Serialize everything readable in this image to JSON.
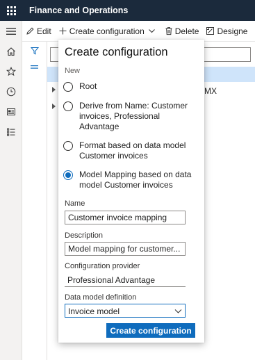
{
  "app": {
    "title": "Finance and Operations"
  },
  "actions": {
    "edit": "Edit",
    "create_configuration": "Create configuration",
    "delete": "Delete",
    "designer": "Designe"
  },
  "background": {
    "row_fragment": "MX"
  },
  "dialog": {
    "title": "Create configuration",
    "section_new": "New",
    "options": [
      {
        "label": "Root",
        "selected": false
      },
      {
        "label": "Derive from Name: Customer invoices, Professional Advantage",
        "selected": false
      },
      {
        "label": "Format based on data model Customer invoices",
        "selected": false
      },
      {
        "label": "Model Mapping based on data model Customer invoices",
        "selected": true
      }
    ],
    "name": {
      "label": "Name",
      "value": "Customer invoice mapping"
    },
    "description": {
      "label": "Description",
      "value": "Model mapping for customer..."
    },
    "configuration_provider": {
      "label": "Configuration provider",
      "value": "Professional Advantage"
    },
    "data_model_definition": {
      "label": "Data model definition",
      "value": "Invoice model"
    },
    "submit": "Create configuration"
  },
  "colors": {
    "topbar": "#1b2a3c",
    "accent": "#0f6cbd",
    "selected_row": "#cfe4fa"
  }
}
